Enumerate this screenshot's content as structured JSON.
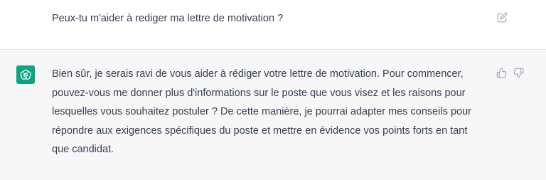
{
  "conversation": {
    "user_message": {
      "text": "Peux-tu m'aider à rediger ma lettre de motivation ?",
      "edit_icon": "edit-icon"
    },
    "assistant_message": {
      "avatar_icon": "openai-logo-icon",
      "lines": [
        "Bien sûr, je serais ravi de vous aider à rédiger votre lettre de motivation. Pour commencer,",
        "pouvez-vous me donner plus d'informations sur le poste que vous visez et les raisons pour",
        "lesquelles vous souhaitez postuler ? De cette manière, je pourrai adapter mes conseils pour",
        "répondre aux exigences spécifiques du poste et mettre en évidence vos points forts en tant",
        "que candidat."
      ],
      "thumbs_up_icon": "thumbs-up-icon",
      "thumbs_down_icon": "thumbs-down-icon"
    }
  },
  "colors": {
    "user_bg": "#ffffff",
    "assistant_bg": "#f7f7f8",
    "avatar_bg": "#10a37f",
    "text": "#374151",
    "icon": "#acacbe"
  }
}
